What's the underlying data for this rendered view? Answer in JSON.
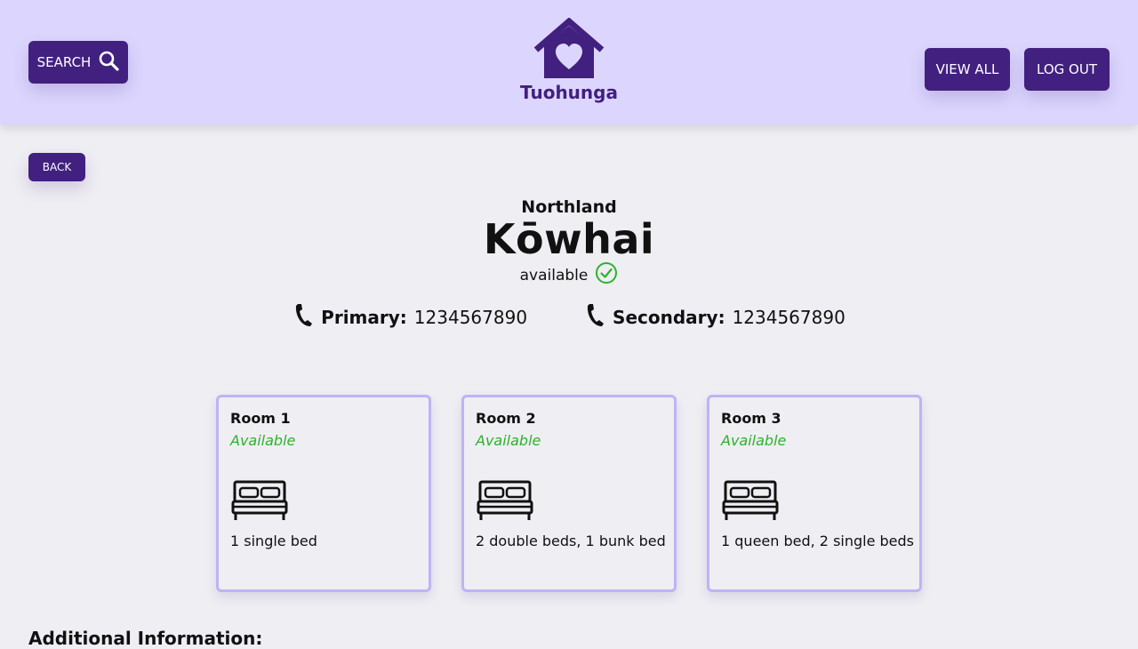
{
  "header": {
    "search_label": "SEARCH",
    "logo_text": "Tuohunga",
    "view_all_label": "VIEW ALL",
    "logout_label": "LOG OUT"
  },
  "back_label": "BACK",
  "property": {
    "region": "Northland",
    "name": "Kōwhai",
    "status": "available"
  },
  "phones": {
    "primary_label": "Primary:",
    "primary_value": "1234567890",
    "secondary_label": "Secondary:",
    "secondary_value": "1234567890"
  },
  "rooms": [
    {
      "title": "Room 1",
      "status": "Available",
      "beds": "1 single bed"
    },
    {
      "title": "Room 2",
      "status": "Available",
      "beds": "2 double beds, 1 bunk bed"
    },
    {
      "title": "Room 3",
      "status": "Available",
      "beds": "1 queen bed, 2 single beds"
    }
  ],
  "additional_info_heading": "Additional Information:",
  "colors": {
    "primary": "#42207f",
    "header_bg": "#dcd6fe",
    "available": "#2bb32b",
    "card_border": "#bfb3f6"
  },
  "icons": [
    "search-icon",
    "house-heart-logo-icon",
    "check-circle-icon",
    "phone-icon",
    "bed-icon"
  ]
}
